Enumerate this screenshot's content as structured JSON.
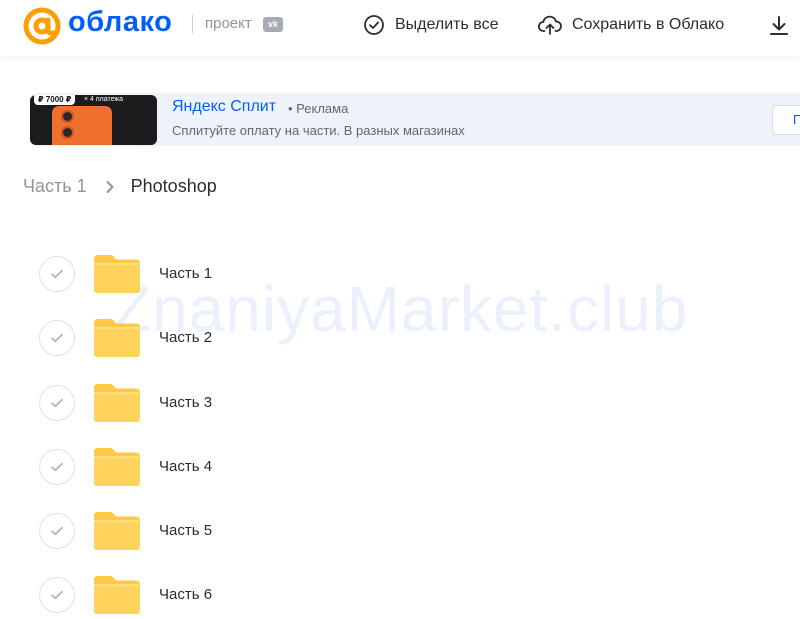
{
  "header": {
    "brand": "облако",
    "project_label": "проект",
    "vk_badge": "vk",
    "select_all_label": "Выделить все",
    "save_to_cloud_label": "Сохранить в Облако",
    "accent_color": "#005ff9"
  },
  "ad": {
    "price_tag": "₽ 7000 ₽",
    "price_note": "× 4 платежа",
    "title": "Яндекс Сплит",
    "marker": "• Реклама",
    "description": "Сплитуйте оплату на части. В разных магазинах",
    "button_label": "П"
  },
  "breadcrumb": {
    "parent": "Часть 1",
    "current": "Photoshop"
  },
  "folders": [
    {
      "name": "Часть 1"
    },
    {
      "name": "Часть 2"
    },
    {
      "name": "Часть 3"
    },
    {
      "name": "Часть 4"
    },
    {
      "name": "Часть 5"
    },
    {
      "name": "Часть 6"
    }
  ],
  "watermark": "ZnaniyaMarket.club",
  "icons": {
    "logo": "at-sign-logo-icon",
    "select_all": "check-circle-icon",
    "save": "cloud-upload-icon",
    "download": "download-icon",
    "chevron": "chevron-right-icon",
    "folder": "folder-icon",
    "check": "check-icon"
  }
}
